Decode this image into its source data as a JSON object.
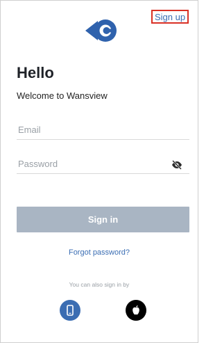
{
  "header": {
    "signup_label": "Sign up"
  },
  "main": {
    "title": "Hello",
    "subtitle": "Welcome to Wansview",
    "email_placeholder": "Email",
    "password_placeholder": "Password",
    "signin_label": "Sign in",
    "forgot_label": "Forgot password?",
    "alt_signin_label": "You can also sign in by"
  },
  "icons": {
    "logo": "wansview-logo",
    "password_toggle": "eye-slash-icon",
    "phone_login": "phone-icon",
    "apple_login": "apple-icon"
  },
  "colors": {
    "accent": "#3a6db3",
    "signin_button": "#a9b5c3",
    "signup_highlight": "#d93025",
    "apple_button": "#000000"
  }
}
